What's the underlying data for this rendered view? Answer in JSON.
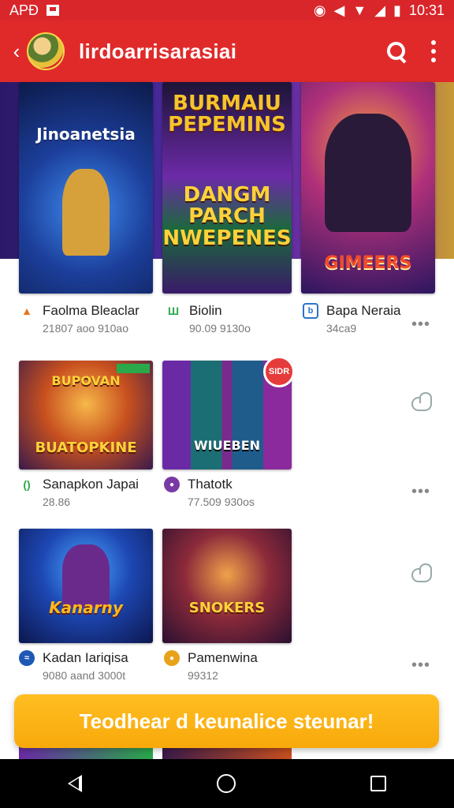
{
  "status_bar": {
    "left_text": "APÐ",
    "time": "10:31"
  },
  "app_bar": {
    "title": "lirdoarrisarasiai"
  },
  "cards": [
    {
      "art_text": "Jinoanetsia",
      "title": "Faolma Bleaclar",
      "subtitle": "21807 aoo 910ao",
      "icon_color": "#e8741a"
    },
    {
      "art_text_top": "BURMAIU\nPEPEMINS",
      "art_text_mid": "DANGM\nPARCH\nNWEPENES",
      "title": "Biolin",
      "subtitle": "90.09 9130o",
      "icon_color": "#2aa84a"
    },
    {
      "art_text": "GIMEERS",
      "title": "Bapa Neraia",
      "subtitle": "34ca9",
      "icon_color": "#2a74c8"
    },
    {
      "art_text_top": "BUPOVAN",
      "art_text": "BUATOPKINE",
      "title": "Sanapkon Japai",
      "subtitle": "28.86",
      "icon_color": "#2aa84a"
    },
    {
      "art_text": "WIUEBEN",
      "badge": "SIDR",
      "title": "Thatotk",
      "subtitle": "77.509 930os",
      "icon_color": "#7a3aa6"
    },
    {
      "art_text": "Kanarny",
      "title": "Kadan Iariqisa",
      "subtitle": "9080 aand 3000t",
      "icon_color": "#1f57b5"
    },
    {
      "art_text": "SNOKERS",
      "title": "Pamenwina",
      "subtitle": "99312",
      "icon_color": "#e8a21a"
    }
  ],
  "more_label": "•••",
  "cta_label": "Teodhear d keunalice steunar!",
  "colors": {
    "brand_red": "#e02a2a",
    "accent_orange": "#f8a90b"
  }
}
